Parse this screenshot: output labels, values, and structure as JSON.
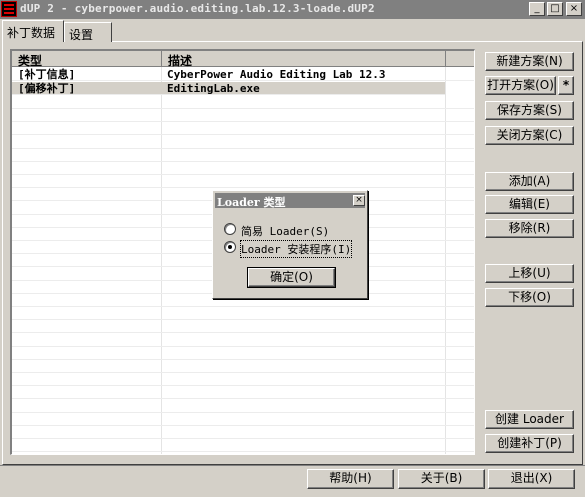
{
  "window": {
    "title": "dUP 2 - cyberpower.audio.editing.lab.12.3-loade.dUP2",
    "min_glyph": "_",
    "max_glyph": "□",
    "close_glyph": "×"
  },
  "tabs": [
    {
      "label": "补丁数据",
      "active": true
    },
    {
      "label": "设置",
      "active": false
    }
  ],
  "table": {
    "columns": [
      "类型",
      "描述"
    ],
    "rows": [
      {
        "type": "[补丁信息]",
        "desc": "CyberPower Audio Editing Lab 12.3",
        "selected": false
      },
      {
        "type": "[偏移补丁]",
        "desc": "EditingLab.exe",
        "selected": true
      }
    ]
  },
  "side_buttons": {
    "new_plan": "新建方案(N)",
    "open_plan": "打开方案(O)",
    "open_star": "*",
    "save_plan": "保存方案(S)",
    "close_plan": "关闭方案(C)",
    "add": "添加(A)",
    "edit": "编辑(E)",
    "remove": "移除(R)",
    "move_up": "上移(U)",
    "move_down": "下移(O)",
    "create_loader": "创建 Loader",
    "create_patch": "创建补丁(P)"
  },
  "dialog": {
    "title": "Loader 类型",
    "close_glyph": "×",
    "options": [
      {
        "label": "简易 Loader(S)",
        "checked": false
      },
      {
        "label": "Loader 安装程序(I)",
        "checked": true
      }
    ],
    "ok": "确定(O)"
  },
  "bottom_buttons": {
    "help": "帮助(H)",
    "about": "关于(B)",
    "exit": "退出(X)"
  },
  "colors": {
    "face": "#d4d0c8",
    "titlebar_inactive": "#808080",
    "selection": "#d4d0c8"
  }
}
